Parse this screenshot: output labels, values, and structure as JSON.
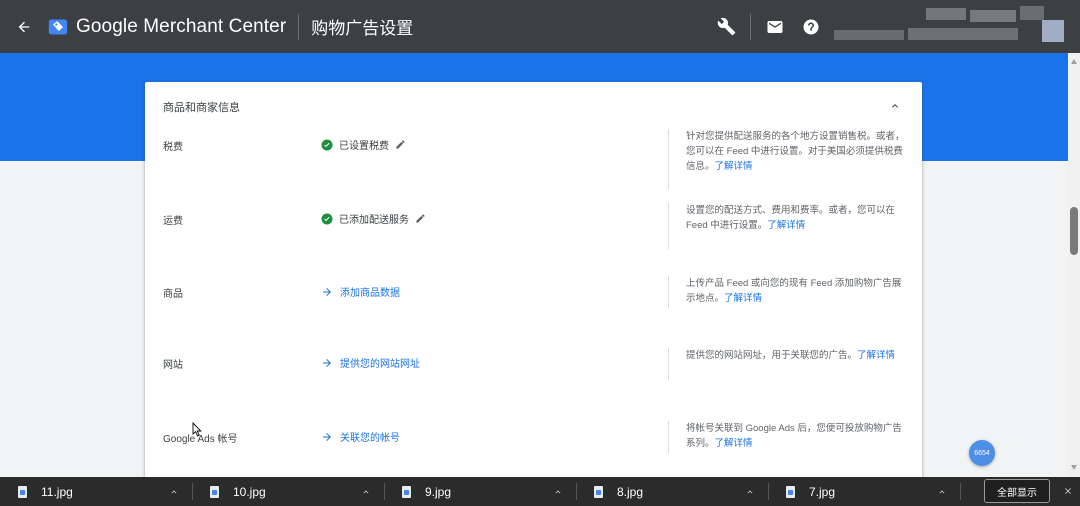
{
  "app": {
    "brand": "Google Merchant Center",
    "page_title": "购物广告设置"
  },
  "icons": {
    "back": "arrow-left-icon",
    "wrench": "wrench-icon",
    "mail": "mail-icon",
    "help": "help-icon"
  },
  "card": {
    "header": "商品和商家信息",
    "rows": [
      {
        "label": "税费",
        "status": "已设置税费",
        "status_type": "done",
        "description": "针对您提供配送服务的各个地方设置销售税。或者，您可以在 Feed 中进行设置。对于美国必须提供税费信息。",
        "link": "了解详情"
      },
      {
        "label": "运费",
        "status": "已添加配送服务",
        "status_type": "done",
        "description": "设置您的配送方式、费用和费率。或者，您可以在 Feed 中进行设置。",
        "link": "了解详情"
      },
      {
        "label": "商品",
        "status": "添加商品数据",
        "status_type": "action",
        "description": "上传产品 Feed 或向您的现有 Feed 添加购物广告展示地点。",
        "link": "了解详情"
      },
      {
        "label": "网站",
        "status": "提供您的网站网址",
        "status_type": "action",
        "description": "提供您的网站网址，用于关联您的广告。",
        "link": "了解详情"
      },
      {
        "label": "Google Ads 帐号",
        "status": "关联您的帐号",
        "status_type": "action",
        "description": "将帐号关联到 Google Ads 后，您便可投放购物广告系列。",
        "link": "了解详情"
      }
    ]
  },
  "badge": "6654",
  "downloads": {
    "files": [
      "11.jpg",
      "10.jpg",
      "9.jpg",
      "8.jpg",
      "7.jpg"
    ],
    "show_all": "全部显示"
  },
  "colors": {
    "topbar": "#3c4043",
    "accent_blue": "#1a73e8",
    "success_green": "#1e8e3e",
    "download_bar": "#2b2b2b"
  }
}
